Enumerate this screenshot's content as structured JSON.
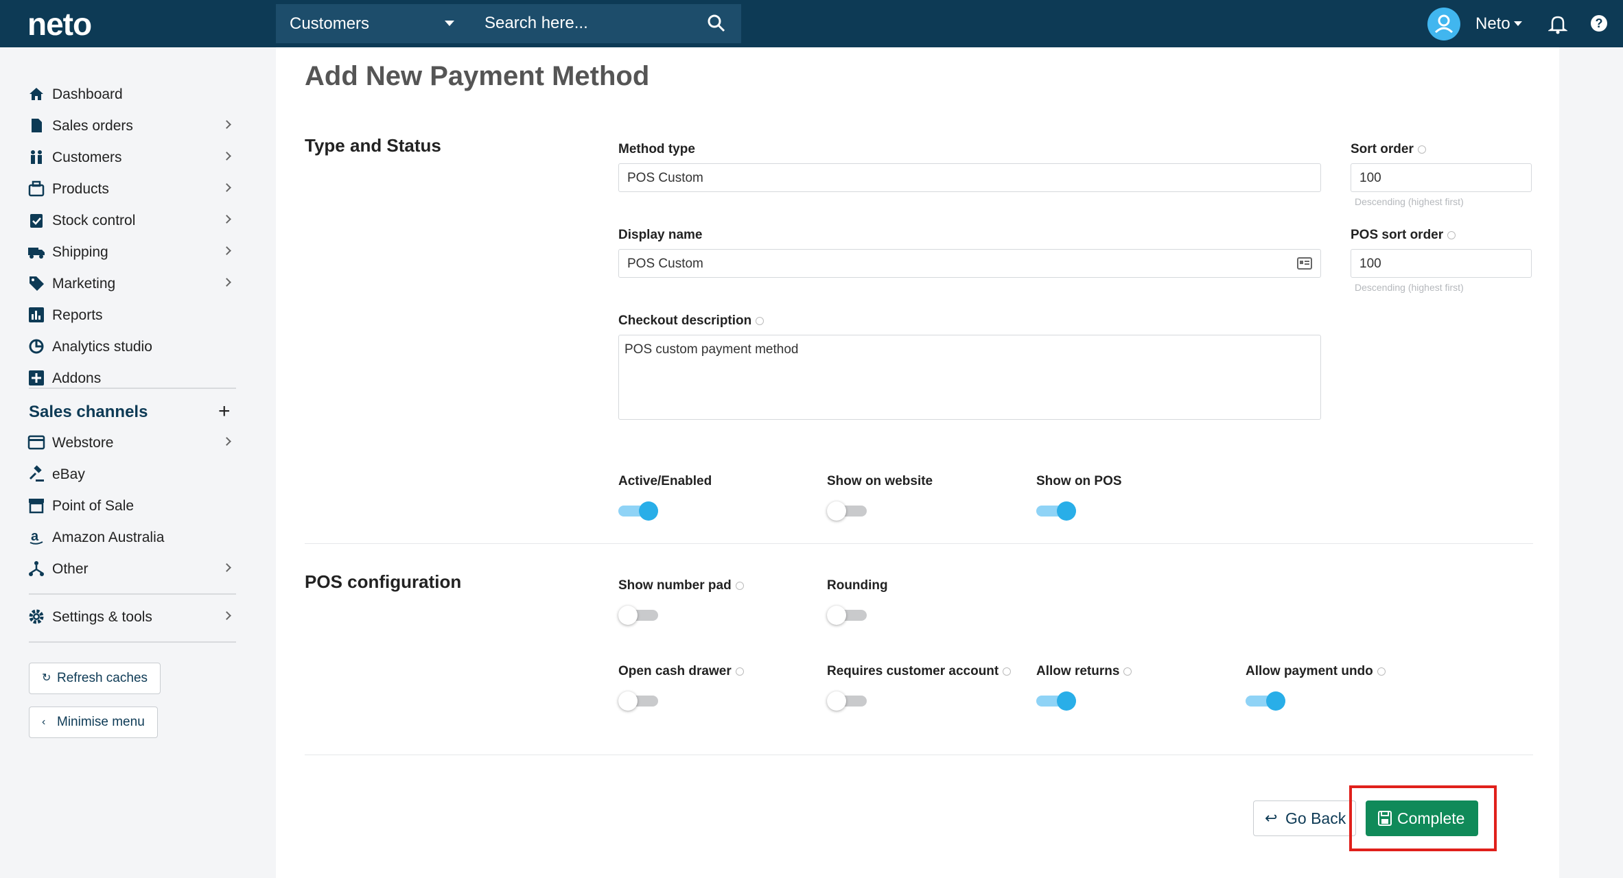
{
  "header": {
    "logo": "neto",
    "select_label": "Customers",
    "search_placeholder": "Search here...",
    "user_name": "Neto",
    "help": "?"
  },
  "sidebar": {
    "items": [
      {
        "label": "Dashboard"
      },
      {
        "label": "Sales orders"
      },
      {
        "label": "Customers"
      },
      {
        "label": "Products"
      },
      {
        "label": "Stock control"
      },
      {
        "label": "Shipping"
      },
      {
        "label": "Marketing"
      },
      {
        "label": "Reports"
      },
      {
        "label": "Analytics studio"
      },
      {
        "label": "Addons"
      }
    ],
    "channels_title": "Sales channels",
    "channels": [
      {
        "label": "Webstore"
      },
      {
        "label": "eBay"
      },
      {
        "label": "Point of Sale"
      },
      {
        "label": "Amazon Australia"
      },
      {
        "label": "Other"
      }
    ],
    "settings": "Settings & tools",
    "refresh": "Refresh caches",
    "minimise": "Minimise menu"
  },
  "page": {
    "title": "Add New Payment Method",
    "type_status_title": "Type and Status",
    "method_type_label": "Method type",
    "method_type_value": "POS Custom",
    "sort_order_label": "Sort order",
    "sort_order_value": "100",
    "sort_hint": "Descending (highest first)",
    "display_name_label": "Display name",
    "display_name_value": "POS Custom",
    "pos_sort_label": "POS sort order",
    "pos_sort_value": "100",
    "pos_sort_hint": "Descending (highest first)",
    "checkout_label": "Checkout description",
    "checkout_value": "POS custom payment method",
    "toggles_status": [
      {
        "label": "Active/Enabled",
        "on": true
      },
      {
        "label": "Show on website",
        "on": false
      },
      {
        "label": "Show on POS",
        "on": true
      }
    ],
    "pos_config_title": "POS configuration",
    "toggles_pos": [
      {
        "label": "Show number pad",
        "on": false
      },
      {
        "label": "Rounding",
        "on": false
      },
      {
        "label": "Open cash drawer",
        "on": false
      },
      {
        "label": "Requires customer account",
        "on": false
      },
      {
        "label": "Allow returns",
        "on": true
      },
      {
        "label": "Allow payment undo",
        "on": true
      }
    ],
    "go_back": "Go Back",
    "complete": "Complete"
  }
}
